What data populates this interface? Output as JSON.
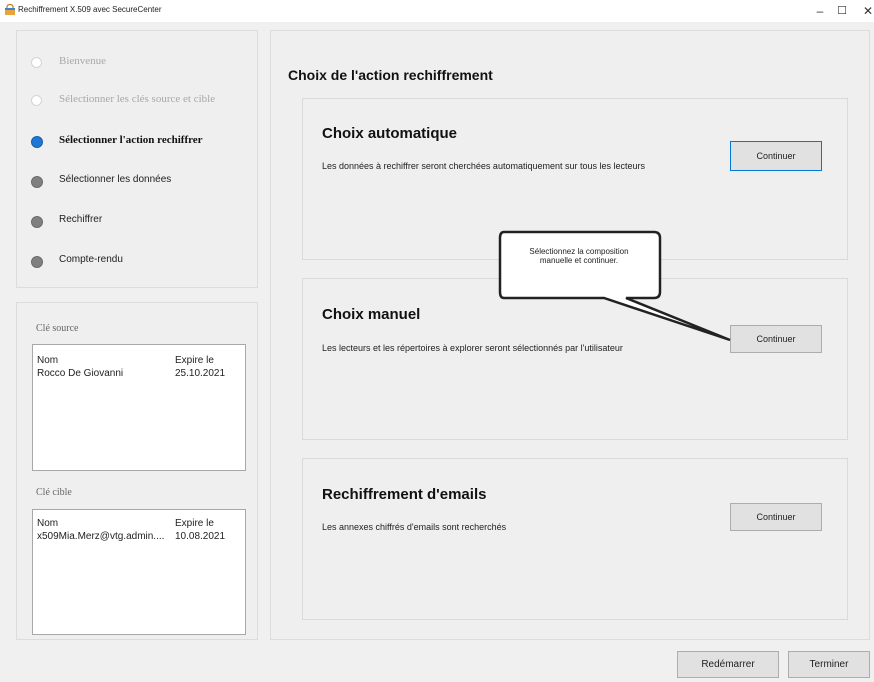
{
  "window": {
    "title": "Rechiffrement X.509 avec SecureCenter",
    "controls": {
      "minimize": "–",
      "maximize": "☐",
      "close": "✕"
    }
  },
  "steps": [
    {
      "label": "Bienvenue",
      "state": "inactive"
    },
    {
      "label": "Sélectionner les clés source et cible",
      "state": "inactive"
    },
    {
      "label": "Sélectionner l'action rechiffrer",
      "state": "current"
    },
    {
      "label": "Sélectionner les données",
      "state": "pending"
    },
    {
      "label": "Rechiffrer",
      "state": "pending"
    },
    {
      "label": "Compte-rendu",
      "state": "pending"
    }
  ],
  "source_key": {
    "label": "Clé source",
    "columns": [
      "Nom",
      "Expire le"
    ],
    "rows": [
      {
        "name": "Rocco De Giovanni",
        "expires": "25.10.2021"
      }
    ]
  },
  "target_key": {
    "label": "Clé cible",
    "columns": [
      "Nom",
      "Expire le"
    ],
    "rows": [
      {
        "name": "x509Mia.Merz@vtg.admin....",
        "expires": "10.08.2021"
      }
    ]
  },
  "main": {
    "heading": "Choix de l'action rechiffrement",
    "actions": [
      {
        "title": "Choix automatique",
        "description": "Les données à rechiffrer seront cherchées automatiquement sur tous les lecteurs",
        "button": "Continuer"
      },
      {
        "title": "Choix manuel",
        "description": "Les lecteurs et les répertoires à explorer seront sélectionnés par l'utilisateur",
        "button": "Continuer"
      },
      {
        "title": "Rechiffrement d'emails",
        "description": "Les annexes chiffrés d'emails sont recherchés",
        "button": "Continuer"
      }
    ]
  },
  "callout": {
    "text": "Sélectionnez la composition manuelle et continuer."
  },
  "footer": {
    "restart": "Redémarrer",
    "finish": "Terminer"
  },
  "colors": {
    "current_step": "#1c78d4",
    "pending_step": "#808080",
    "inactive_step": "#d4d4d4",
    "focus_border": "#0078d7"
  },
  "icons": {
    "app": "app-lock-icon"
  }
}
